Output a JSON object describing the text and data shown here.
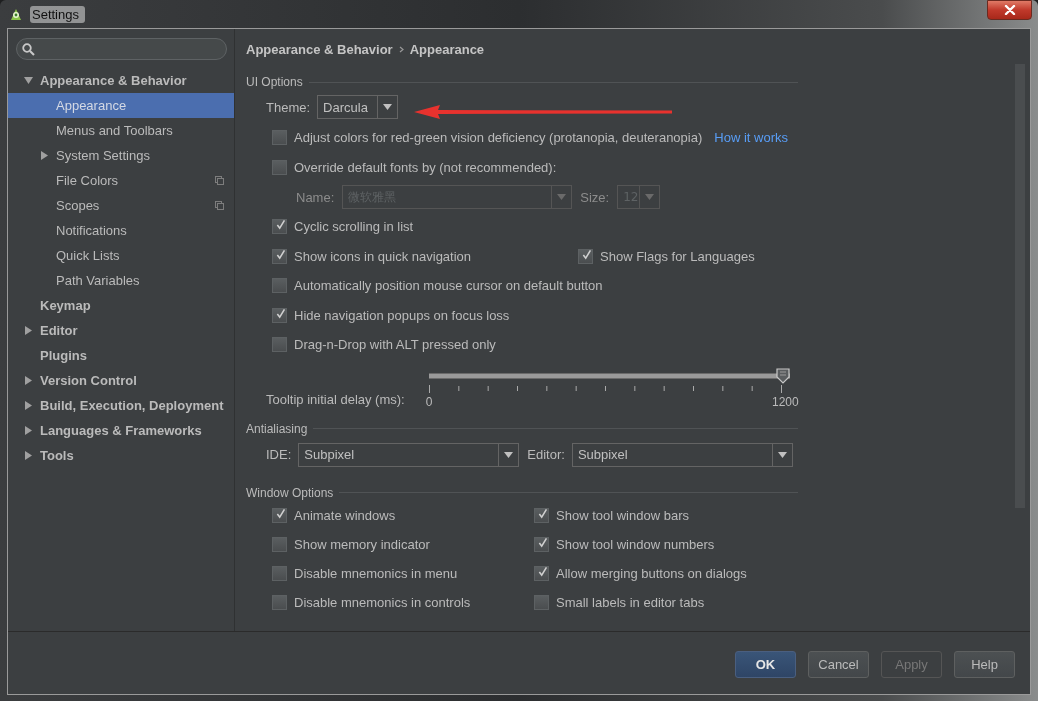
{
  "window": {
    "title": "Settings"
  },
  "sidebar": {
    "items": [
      {
        "label": "Appearance & Behavior",
        "expanded": true,
        "selected": false,
        "children": [
          {
            "label": "Appearance",
            "selected": true
          },
          {
            "label": "Menus and Toolbars",
            "selected": false
          },
          {
            "label": "System Settings",
            "expanded": false,
            "selected": false
          },
          {
            "label": "File Colors",
            "project_level": true,
            "selected": false
          },
          {
            "label": "Scopes",
            "project_level": true,
            "selected": false
          },
          {
            "label": "Notifications",
            "selected": false
          },
          {
            "label": "Quick Lists",
            "selected": false
          },
          {
            "label": "Path Variables",
            "selected": false
          }
        ]
      },
      {
        "label": "Keymap",
        "selected": false
      },
      {
        "label": "Editor",
        "expanded": false,
        "selected": false
      },
      {
        "label": "Plugins",
        "selected": false
      },
      {
        "label": "Version Control",
        "expanded": false,
        "selected": false
      },
      {
        "label": "Build, Execution, Deployment",
        "expanded": false,
        "selected": false
      },
      {
        "label": "Languages & Frameworks",
        "expanded": false,
        "selected": false
      },
      {
        "label": "Tools",
        "expanded": false,
        "selected": false
      }
    ]
  },
  "breadcrumb": [
    "Appearance & Behavior",
    "Appearance"
  ],
  "sections": [
    {
      "title": "UI Options",
      "rows": [
        {
          "kind": "combo",
          "items": [
            {
              "label": "Theme:",
              "value": "Darcula"
            }
          ]
        },
        {
          "kind": "checkboxes",
          "items": [
            {
              "label": "Adjust colors for red-green vision deficiency (protanopia, deuteranopia)",
              "checked": false,
              "link": "How it works"
            }
          ]
        },
        {
          "kind": "checkboxes",
          "items": [
            {
              "label": "Override default fonts by (not recommended):",
              "checked": false
            }
          ]
        },
        {
          "kind": "font",
          "disabled": true,
          "name_label": "Name:",
          "name_value": "微软雅黑",
          "size_label": "Size:",
          "size_value": "12"
        },
        {
          "kind": "checkboxes",
          "items": [
            {
              "label": "Cyclic scrolling in list",
              "checked": true
            }
          ]
        },
        {
          "kind": "checkboxes",
          "items": [
            {
              "label": "Show icons in quick navigation",
              "checked": true
            },
            {
              "label": "Show Flags for Languages",
              "checked": true
            }
          ]
        },
        {
          "kind": "checkboxes",
          "items": [
            {
              "label": "Automatically position mouse cursor on default button",
              "checked": false
            }
          ]
        },
        {
          "kind": "checkboxes",
          "items": [
            {
              "label": "Hide navigation popups on focus loss",
              "checked": true
            }
          ]
        },
        {
          "kind": "checkboxes",
          "items": [
            {
              "label": "Drag-n-Drop with ALT pressed only",
              "checked": false
            }
          ]
        },
        {
          "kind": "slider",
          "label": "Tooltip initial delay (ms):",
          "level": 1,
          "min_label": "0",
          "max_label": "1200"
        }
      ]
    },
    {
      "title": "Antialiasing",
      "rows": [
        {
          "kind": "combo",
          "items": [
            {
              "label": "IDE:",
              "value": "Subpixel"
            },
            {
              "label": "Editor:",
              "value": "Subpixel"
            }
          ]
        }
      ]
    },
    {
      "title": "Window Options",
      "rows": [
        {
          "kind": "checkboxes",
          "items": [
            {
              "label": "Animate windows",
              "checked": true
            },
            {
              "label": "Show tool window bars",
              "checked": true
            }
          ]
        },
        {
          "kind": "checkboxes",
          "items": [
            {
              "label": "Show memory indicator",
              "checked": false
            },
            {
              "label": "Show tool window numbers",
              "checked": true
            }
          ]
        },
        {
          "kind": "checkboxes",
          "items": [
            {
              "label": "Disable mnemonics in menu",
              "checked": false
            },
            {
              "label": "Allow merging buttons on dialogs",
              "checked": true
            }
          ]
        },
        {
          "kind": "checkboxes",
          "items": [
            {
              "label": "Disable mnemonics in controls",
              "checked": false
            },
            {
              "label": "Small labels in editor tabs",
              "checked": false
            }
          ]
        }
      ]
    }
  ],
  "buttons": [
    {
      "label": "OK",
      "default": true,
      "disabled": false
    },
    {
      "label": "Cancel",
      "default": false,
      "disabled": false
    },
    {
      "label": "Apply",
      "default": false,
      "disabled": true
    },
    {
      "label": "Help",
      "default": false,
      "disabled": false
    }
  ]
}
